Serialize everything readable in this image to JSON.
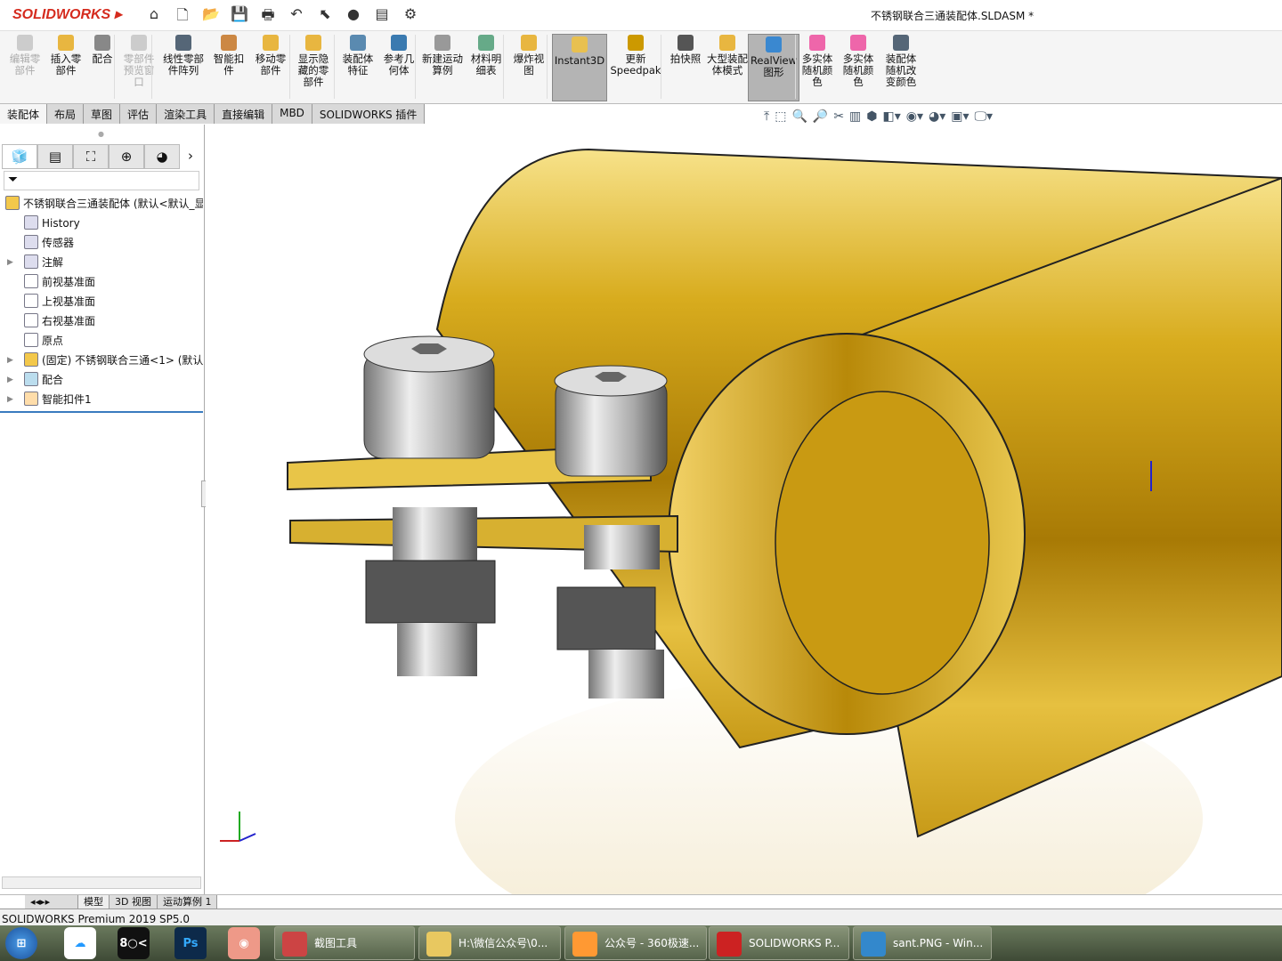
{
  "app": {
    "logo": "SOLIDWORKS",
    "document_title": "不锈钢联合三通装配体.SLDASM *"
  },
  "quick_access": [
    "home-icon",
    "new-icon",
    "open-icon",
    "save-icon",
    "print-icon",
    "undo-icon",
    "select-icon",
    "rebuild-icon",
    "file-properties-icon",
    "options-icon"
  ],
  "commands": [
    {
      "label": "编辑零部件",
      "disabled": true
    },
    {
      "label": "插入零部件"
    },
    {
      "label": "配合"
    },
    {
      "label": "零部件预览窗口",
      "disabled": true
    },
    {
      "label": "线性零部件阵列"
    },
    {
      "label": "智能扣件"
    },
    {
      "label": "移动零部件"
    },
    {
      "label": "显示隐藏的零部件"
    },
    {
      "label": "装配体特征"
    },
    {
      "label": "参考几何体"
    },
    {
      "label": "新建运动算例"
    },
    {
      "label": "材料明细表"
    },
    {
      "label": "爆炸视图"
    },
    {
      "label": "Instant3D",
      "active": true
    },
    {
      "label": "更新Speedpak"
    },
    {
      "label": "拍快照"
    },
    {
      "label": "大型装配体模式"
    },
    {
      "label": "RealView图形",
      "active": true
    },
    {
      "label": "多实体随机颜色"
    },
    {
      "label": "多实体随机颜色"
    },
    {
      "label": "装配体随机改变颜色"
    }
  ],
  "tabs": [
    "装配体",
    "布局",
    "草图",
    "评估",
    "渲染工具",
    "直接编辑",
    "MBD",
    "SOLIDWORKS 插件"
  ],
  "active_tab": "装配体",
  "feature_tree": {
    "root": "不锈钢联合三通装配体 (默认<默认_显",
    "items": [
      {
        "label": "History"
      },
      {
        "label": "传感器"
      },
      {
        "label": "注解",
        "expandable": true
      },
      {
        "label": "前视基准面"
      },
      {
        "label": "上视基准面"
      },
      {
        "label": "右视基准面"
      },
      {
        "label": "原点"
      },
      {
        "label": "(固定) 不锈钢联合三通<1> (默认",
        "expandable": true
      },
      {
        "label": "配合",
        "expandable": true
      },
      {
        "label": "智能扣件1",
        "expandable": true
      }
    ]
  },
  "bottom_tabs": [
    "模型",
    "3D 视图",
    "运动算例 1"
  ],
  "status": "SOLIDWORKS Premium 2019 SP5.0",
  "taskbar": [
    {
      "label": "截图工具"
    },
    {
      "label": "H:\\微信公众号\\0..."
    },
    {
      "label": "公众号 - 360极速..."
    },
    {
      "label": "SOLIDWORKS P..."
    },
    {
      "label": "sant.PNG - Win..."
    }
  ],
  "colors": {
    "brand": "#d52b1e",
    "gold": "#d9b01c",
    "active_cmd": "#b4b4b4"
  }
}
